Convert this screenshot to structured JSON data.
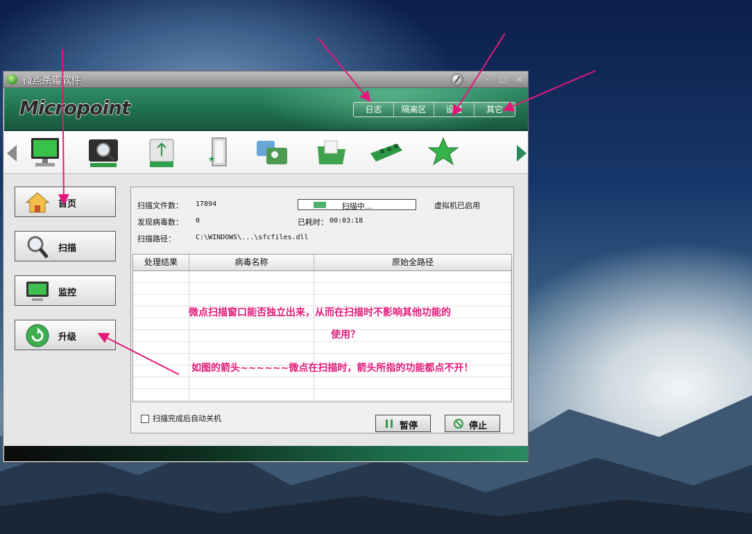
{
  "window": {
    "title": "微点杀毒软件",
    "logo": "Micropoint"
  },
  "top_menu": [
    "日志",
    "隔离区",
    "设置",
    "其它"
  ],
  "toolbar_icons": [
    "monitor-icon",
    "magnifier-scan-icon",
    "usb-drive-icon",
    "door-star-icon",
    "folders-icon",
    "green-folder-icon",
    "memory-chip-icon",
    "green-star-icon"
  ],
  "sidebar": {
    "items": [
      {
        "label": "首页",
        "icon": "home-icon"
      },
      {
        "label": "扫描",
        "icon": "magnifier-icon"
      },
      {
        "label": "监控",
        "icon": "monitor-icon"
      },
      {
        "label": "升级",
        "icon": "refresh-icon"
      }
    ]
  },
  "scan": {
    "files_label": "扫描文件数：",
    "files_value": "17894",
    "virus_label": "发现病毒数：",
    "virus_value": "0",
    "path_label": "扫描路径：",
    "path_value": "C:\\WINDOWS\\...\\sfcfiles.dll",
    "status_text": "扫描中...",
    "progress": 0.12,
    "elapsed_label": "已耗时：",
    "elapsed_value": "00:03:18",
    "vm_status": "虚拟机已启用"
  },
  "results_table": {
    "columns": [
      "处理结果",
      "病毒名称",
      "原始全路径"
    ],
    "rows": []
  },
  "footer": {
    "auto_shutdown_label": "扫描完成后自动关机",
    "pause_label": "暂停",
    "stop_label": "停止"
  },
  "annotations": {
    "line1": "微点扫描窗口能否独立出来，从而在扫描时不影响其他功能的",
    "line2": "使用？",
    "line3": "如图的箭头~~~~~~微点在扫描时，箭头所指的功能都点不开！"
  },
  "colors": {
    "brand_green": "#1f6f4d",
    "annotation_pink": "#e2197a"
  }
}
